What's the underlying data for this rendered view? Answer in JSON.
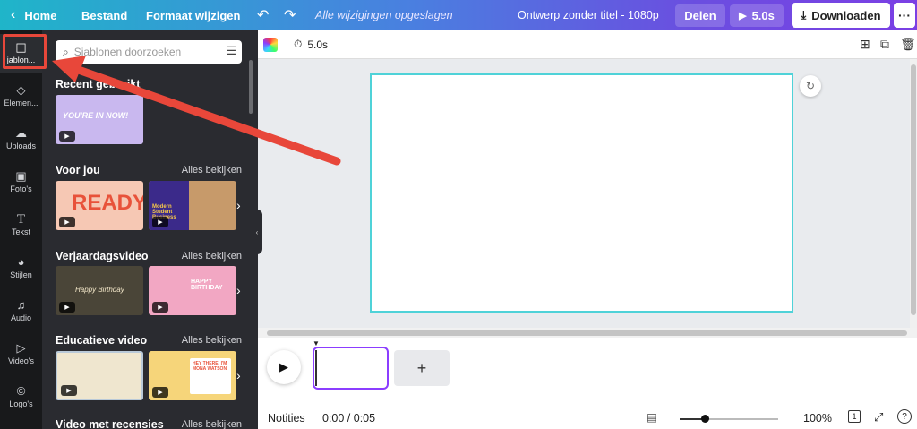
{
  "topbar": {
    "home": "Home",
    "file": "Bestand",
    "resize": "Formaat wijzigen",
    "saved": "Alle wijzigingen opgeslagen",
    "design_title": "Ontwerp zonder titel - 1080p",
    "share": "Delen",
    "play": "5.0s",
    "download": "Downloaden"
  },
  "rail": [
    {
      "label": "jablon...",
      "icon": "layout-icon"
    },
    {
      "label": "Elemen...",
      "icon": "shapes-icon"
    },
    {
      "label": "Uploads",
      "icon": "cloud-upload-icon"
    },
    {
      "label": "Foto's",
      "icon": "photo-icon"
    },
    {
      "label": "Tekst",
      "icon": "text-icon"
    },
    {
      "label": "Stijlen",
      "icon": "palette-icon"
    },
    {
      "label": "Audio",
      "icon": "music-icon"
    },
    {
      "label": "Video's",
      "icon": "video-icon"
    },
    {
      "label": "Logo's",
      "icon": "logo-icon"
    }
  ],
  "panel": {
    "search_placeholder": "Sjablonen doorzoeken",
    "recent": "Recent gebruikt",
    "recent_thumb_text": "YOU'RE IN NOW!",
    "sections": [
      {
        "title": "Voor jou",
        "see_all": "Alles bekijken",
        "thumb1_text": "READY",
        "thumb2_text": "Modern Student Business"
      },
      {
        "title": "Verjaardagsvideo",
        "see_all": "Alles bekijken",
        "thumb1_text": "Happy Birthday",
        "thumb2_text": "HAPPY BIRTHDAY"
      },
      {
        "title": "Educatieve video",
        "see_all": "Alles bekijken",
        "thumb1_text": "",
        "thumb2_text": "HEY THERE! I'M MONA WATSON"
      },
      {
        "title": "Video met recensies",
        "see_all": "Alles bekijken"
      }
    ]
  },
  "editor": {
    "duration": "5.0s",
    "add_page": "+"
  },
  "bottom": {
    "notes": "Notities",
    "time": "0:00 / 0:05",
    "zoom": "100%",
    "page_count": "1",
    "zoom_level": 0.25
  },
  "colors": {
    "accent": "#8b3dff",
    "canvas_border": "#4fd2d8",
    "highlight": "#e8473a"
  }
}
